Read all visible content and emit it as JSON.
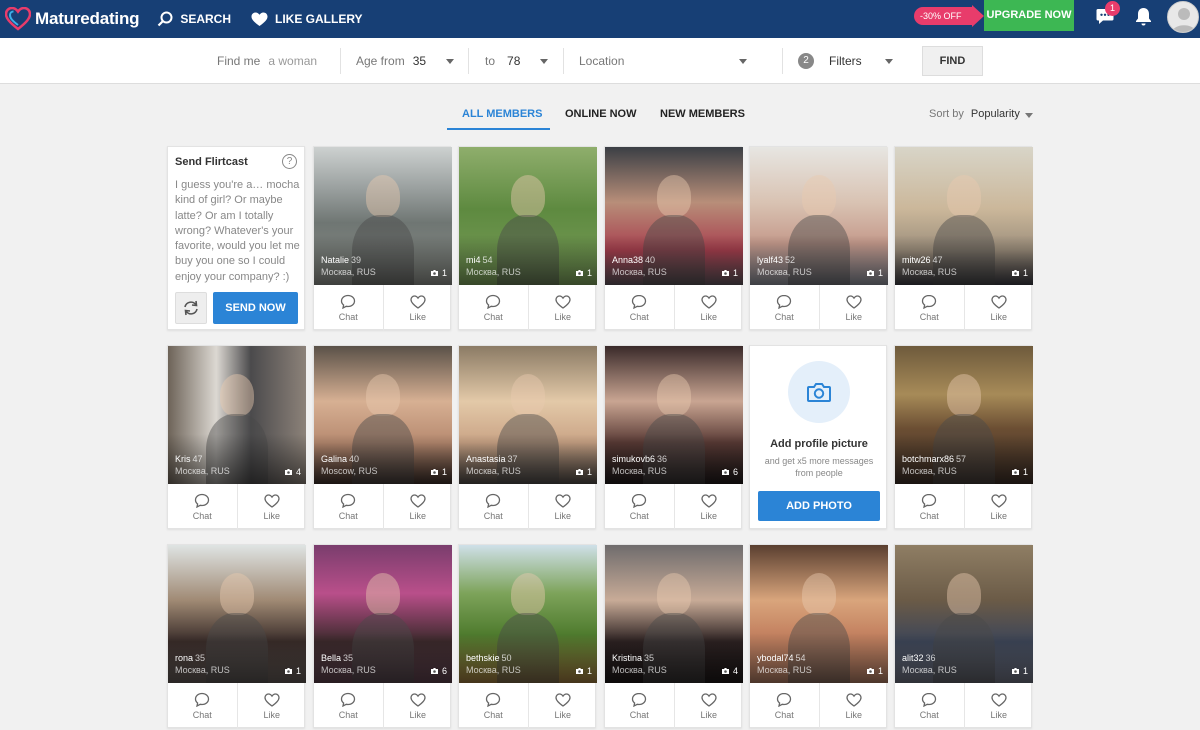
{
  "header": {
    "logo_text": "Maturedating",
    "nav": [
      {
        "label": "SEARCH",
        "icon": "search-icon"
      },
      {
        "label": "LIKE GALLERY",
        "icon": "heart-icon"
      }
    ],
    "discount_label": "-30% OFF",
    "upgrade_label": "UPGRADE NOW",
    "messages_badge": "1",
    "accent_color": "#173f75"
  },
  "filters": {
    "find_me_label": "Find me",
    "find_me_value": "a woman",
    "age_from_label": "Age from",
    "age_from_value": "35",
    "age_to_label": "to",
    "age_to_value": "78",
    "location_placeholder": "Location",
    "filters_count": "2",
    "filters_label": "Filters",
    "find_button": "FIND"
  },
  "tabs": [
    {
      "label": "ALL MEMBERS",
      "active": true
    },
    {
      "label": "ONLINE NOW",
      "active": false
    },
    {
      "label": "NEW MEMBERS",
      "active": false
    }
  ],
  "sort": {
    "label": "Sort by",
    "value": "Popularity"
  },
  "flirtcast": {
    "title": "Send Flirtcast",
    "help": "?",
    "message": "I guess you're a… mocha kind of girl? Or maybe latte? Or am I totally wrong? Whatever's your favorite, would you let me buy you one so I could enjoy your company? :)",
    "send_button": "SEND NOW"
  },
  "add_photo": {
    "title": "Add profile picture",
    "subtitle": "and get x5 more messages from people",
    "button": "ADD PHOTO"
  },
  "action_labels": {
    "chat": "Chat",
    "like": "Like"
  },
  "members": [
    {
      "name": "Natalie",
      "age": "39",
      "location": "Москва, RUS",
      "photos": "1"
    },
    {
      "name": "mi4",
      "age": "54",
      "location": "Москва, RUS",
      "photos": "1"
    },
    {
      "name": "Anna38",
      "age": "40",
      "location": "Москва, RUS",
      "photos": "1"
    },
    {
      "name": "lyalf43",
      "age": "52",
      "location": "Москва, RUS",
      "photos": "1"
    },
    {
      "name": "mitw26",
      "age": "47",
      "location": "Москва, RUS",
      "photos": "1"
    },
    {
      "name": "Kris",
      "age": "47",
      "location": "Москва, RUS",
      "photos": "4"
    },
    {
      "name": "Galina",
      "age": "40",
      "location": "Moscow, RUS",
      "photos": "1"
    },
    {
      "name": "Anastasia",
      "age": "37",
      "location": "Москва, RUS",
      "photos": "1"
    },
    {
      "name": "simukovb6",
      "age": "36",
      "location": "Москва, RUS",
      "photos": "6"
    },
    {
      "name": "botchmarx86",
      "age": "57",
      "location": "Москва, RUS",
      "photos": "1"
    },
    {
      "name": "rona",
      "age": "35",
      "location": "Москва, RUS",
      "photos": "1"
    },
    {
      "name": "Bella",
      "age": "35",
      "location": "Москва, RUS",
      "photos": "6"
    },
    {
      "name": "bethskie",
      "age": "50",
      "location": "Москва, RUS",
      "photos": "1"
    },
    {
      "name": "Kristina",
      "age": "35",
      "location": "Москва, RUS",
      "photos": "4"
    },
    {
      "name": "ybodal74",
      "age": "54",
      "location": "Москва, RUS",
      "photos": "1"
    },
    {
      "name": "alit32",
      "age": "36",
      "location": "Москва, RUS",
      "photos": "1"
    }
  ]
}
